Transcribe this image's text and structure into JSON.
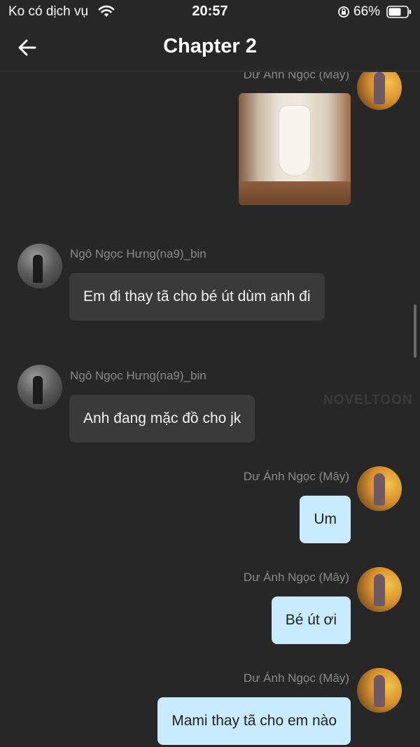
{
  "status_bar": {
    "carrier": "Ko có dịch vụ",
    "time": "20:57",
    "battery": "66%"
  },
  "header": {
    "title": "Chapter 2"
  },
  "messages": [
    {
      "sender": "Dư Ánh Ngọc (Mây)",
      "side": "right",
      "type": "image"
    },
    {
      "sender": "Ngô Ngọc Hưng(na9)_bin",
      "side": "left",
      "text": "Em đi thay tã cho bé út dùm anh đi"
    },
    {
      "sender": "Ngô Ngọc Hưng(na9)_bin",
      "side": "left",
      "text": "Anh đang mặc đồ cho jk"
    },
    {
      "sender": "Dư Ánh Ngọc (Mây)",
      "side": "right",
      "text": "Um"
    },
    {
      "sender": "Dư Ánh Ngọc (Mây)",
      "side": "right",
      "text": "Bé út ơi"
    },
    {
      "sender": "Dư Ánh Ngọc (Mây)",
      "side": "right",
      "text": "Mami thay tã cho em nào"
    }
  ],
  "watermark": "NOVELTOON",
  "colors": {
    "background": "#272727",
    "bubble_left": "#3a3a3a",
    "bubble_right": "#c8ebff"
  }
}
